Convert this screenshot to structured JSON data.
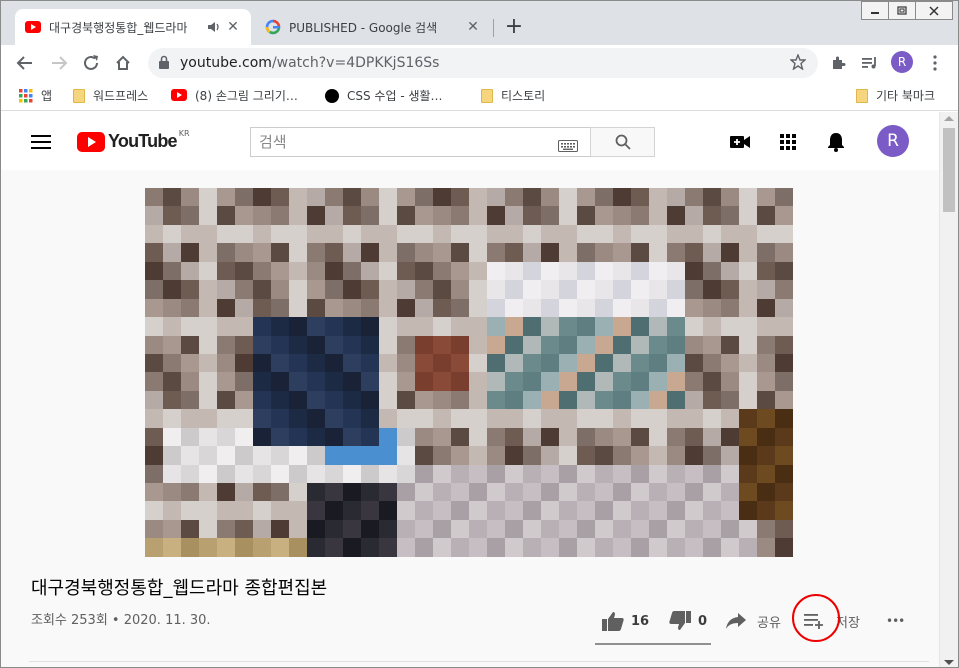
{
  "browser": {
    "tabs": [
      {
        "title": "대구경북행정통합_웹드라마",
        "favicon": "youtube-icon",
        "audio": "speaker-icon"
      },
      {
        "title": "PUBLISHED - Google 검색",
        "favicon": "google-icon"
      }
    ],
    "new_tab_label": "+",
    "url_host": "youtube.com",
    "url_path": "/watch?v=4DPKKjS16Ss",
    "profile_initial": "R",
    "bookmarks": [
      {
        "label": "앱",
        "icon": "apps-grid-icon"
      },
      {
        "label": "워드프레스",
        "icon": "folder-icon"
      },
      {
        "label": "(8) 손그림 그리기…",
        "icon": "youtube-icon"
      },
      {
        "label": "CSS 수업 - 생활…",
        "icon": "black-circle-icon"
      },
      {
        "label": "티스토리",
        "icon": "folder-icon"
      },
      {
        "label": "기타 북마크",
        "icon": "folder-icon"
      }
    ]
  },
  "youtube": {
    "logo_text": "YouTube",
    "logo_region": "KR",
    "search_placeholder": "검색",
    "avatar_initial": "R",
    "video": {
      "title": "대구경북행정통합_웹드라마 종합편집본",
      "meta": "조회수 253회 • 2020. 11. 30.",
      "likes": "16",
      "dislikes": "0",
      "share_label": "공유",
      "save_label": "저장",
      "more_label": "•••"
    }
  },
  "colors": {
    "youtube_red": "#ff0000",
    "avatar_purple": "#7b5cc6",
    "annotation_circle": "#ee0000"
  }
}
